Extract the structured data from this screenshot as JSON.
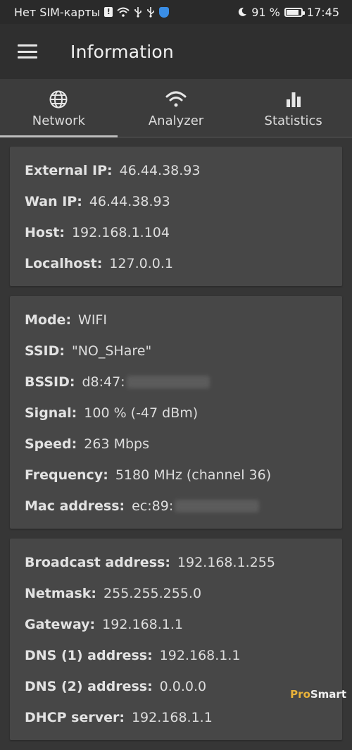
{
  "status_bar": {
    "carrier": "Нет SIM-карты",
    "icons": [
      "alert-icon",
      "wifi-icon",
      "usb-icon",
      "usb-icon",
      "shield-icon",
      "moon-icon",
      "battery-icon"
    ],
    "battery": "91 %",
    "time": "17:45"
  },
  "app_bar": {
    "menu_icon": "hamburger-menu-icon",
    "title": "Information"
  },
  "tabs": [
    {
      "label": "Network",
      "icon": "globe-icon",
      "active": true
    },
    {
      "label": "Analyzer",
      "icon": "wifi-icon",
      "active": false
    },
    {
      "label": "Statistics",
      "icon": "bar-chart-icon",
      "active": false
    }
  ],
  "cards": {
    "ip": {
      "external_ip_label": "External IP:",
      "external_ip": "46.44.38.93",
      "wan_ip_label": "Wan IP:",
      "wan_ip": "46.44.38.93",
      "host_label": "Host:",
      "host": "192.168.1.104",
      "localhost_label": "Localhost:",
      "localhost": "127.0.0.1"
    },
    "wifi": {
      "mode_label": "Mode:",
      "mode": "WIFI",
      "ssid_label": "SSID:",
      "ssid": "\"NO_SHare\"",
      "bssid_label": "BSSID:",
      "bssid": "d8:47:",
      "signal_label": "Signal:",
      "signal": "100 % (-47 dBm)",
      "speed_label": "Speed:",
      "speed": "263 Mbps",
      "frequency_label": "Frequency:",
      "frequency": "5180 MHz (channel 36)",
      "mac_label": "Mac address:",
      "mac": "ec:89:"
    },
    "dhcp": {
      "broadcast_label": "Broadcast address:",
      "broadcast": "192.168.1.255",
      "netmask_label": "Netmask:",
      "netmask": "255.255.255.0",
      "gateway_label": "Gateway:",
      "gateway": "192.168.1.1",
      "dns1_label": "DNS (1) address:",
      "dns1": "192.168.1.1",
      "dns2_label": "DNS (2) address:",
      "dns2": "0.0.0.0",
      "dhcp_label": "DHCP server:",
      "dhcp": "192.168.1.1"
    }
  },
  "watermark": {
    "part1": "Pro",
    "part2": "Smart"
  }
}
